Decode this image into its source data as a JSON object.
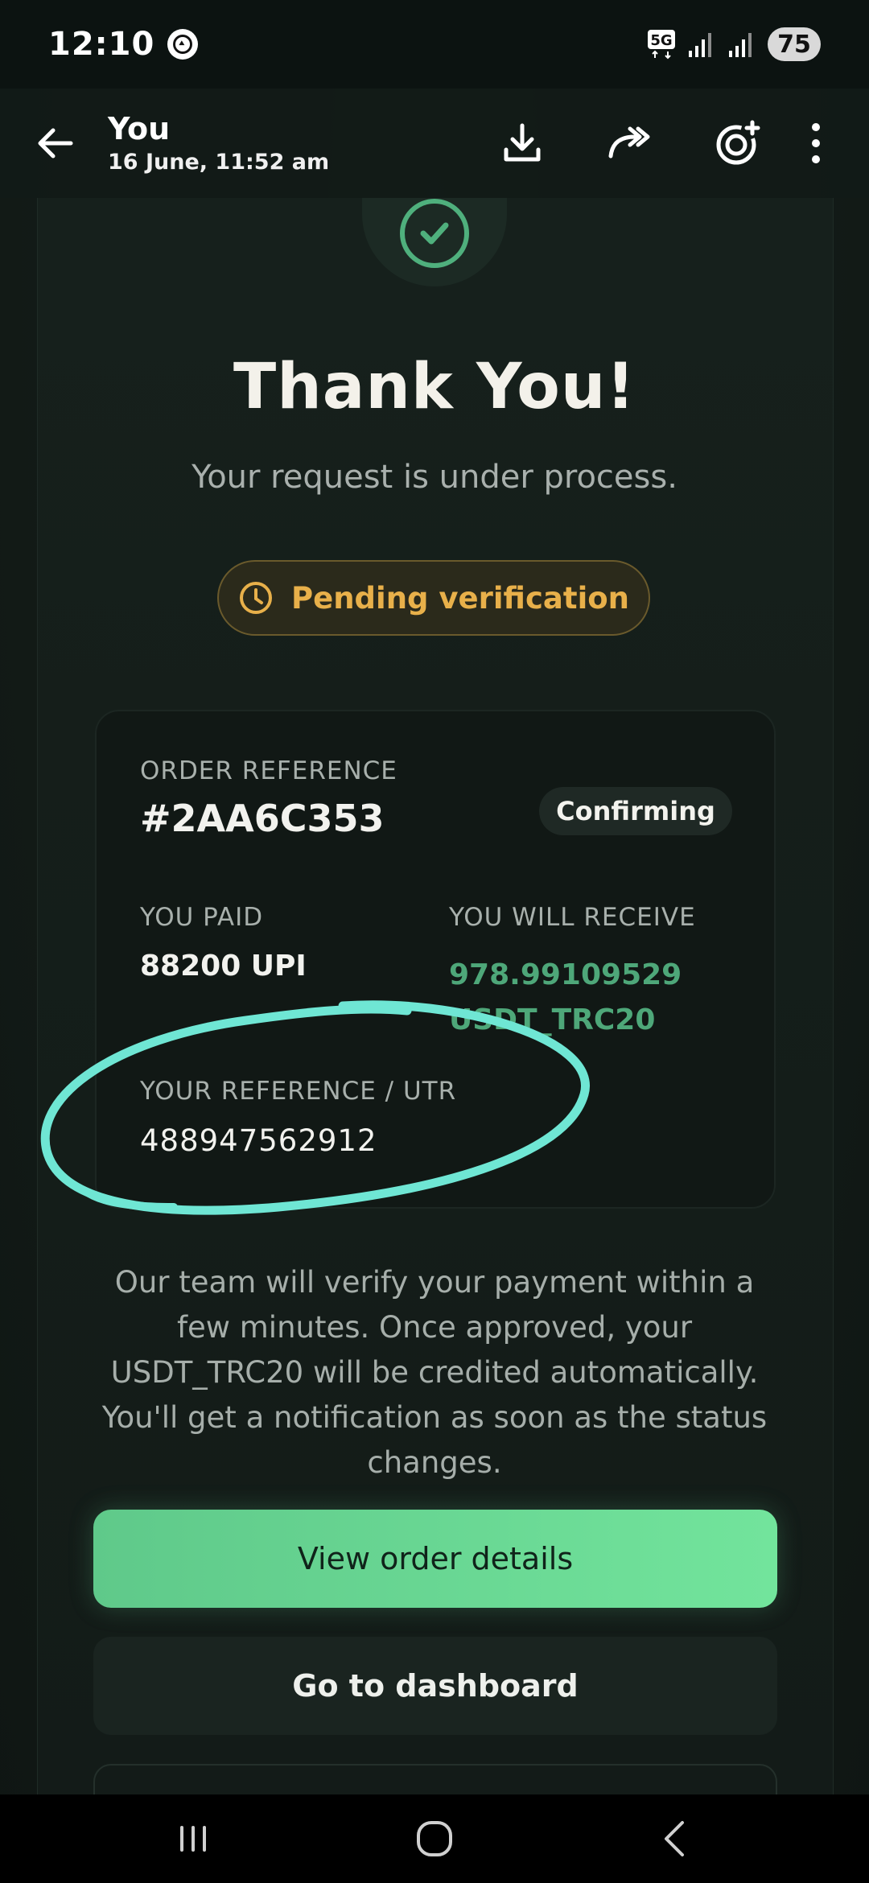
{
  "status_bar": {
    "time": "12:10",
    "network": "5G",
    "battery": "75"
  },
  "viewer": {
    "sender": "You",
    "timestamp": "16 June, 11:52 am"
  },
  "receipt": {
    "title": "Thank You!",
    "subtitle": "Your request is under process.",
    "status_pill": "Pending verification",
    "order_reference_label": "ORDER REFERENCE",
    "order_reference": "#2AA6C353",
    "order_status": "Confirming",
    "you_paid_label": "YOU PAID",
    "you_paid": "88200 UPI",
    "you_receive_label": "YOU WILL RECEIVE",
    "you_receive": "978.99109529 USDT_TRC20",
    "utr_label": "YOUR REFERENCE / UTR",
    "utr": "488947562912",
    "info": "Our team will verify your payment within a few minutes. Once approved, your USDT_TRC20 will be credited automatically. You'll get a notification as soon as the status changes.",
    "primary_button": "View order details",
    "secondary_button": "Go to dashboard"
  },
  "colors": {
    "accent_green": "#6ad795",
    "pending_amber": "#e8b04a",
    "annotation_cyan": "#6fe6d4"
  }
}
